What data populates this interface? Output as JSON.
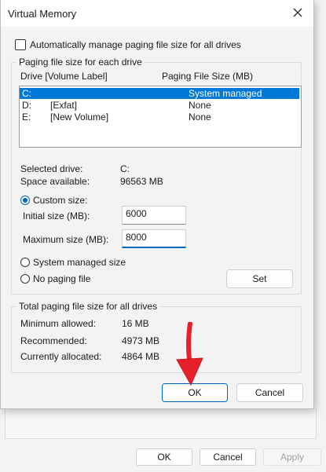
{
  "parent": {
    "ok_label": "OK",
    "cancel_label": "Cancel",
    "apply_label": "Apply"
  },
  "dialog": {
    "title": "Virtual Memory",
    "auto_manage_label": "Automatically manage paging file size for all drives",
    "auto_manage_checked": false,
    "per_drive_group": "Paging file size for each drive",
    "columns": {
      "drive": "Drive  [Volume Label]",
      "size": "Paging File Size (MB)"
    },
    "drives": [
      {
        "drive": "C:",
        "label": "",
        "size": "System managed",
        "selected": true
      },
      {
        "drive": "D:",
        "label": "[Exfat]",
        "size": "None",
        "selected": false
      },
      {
        "drive": "E:",
        "label": "[New Volume]",
        "size": "None",
        "selected": false
      }
    ],
    "selected_drive_label": "Selected drive:",
    "selected_drive_value": "C:",
    "space_available_label": "Space available:",
    "space_available_value": "96563 MB",
    "custom_size_label": "Custom size:",
    "initial_size_label": "Initial size (MB):",
    "initial_size_value": "6000",
    "maximum_size_label": "Maximum size (MB):",
    "maximum_size_value": "8000",
    "system_managed_label": "System managed size",
    "no_paging_label": "No paging file",
    "set_label": "Set",
    "total_group": "Total paging file size for all drives",
    "minimum_label": "Minimum allowed:",
    "minimum_value": "16 MB",
    "recommended_label": "Recommended:",
    "recommended_value": "4973 MB",
    "allocated_label": "Currently allocated:",
    "allocated_value": "4864 MB",
    "ok_label": "OK",
    "cancel_label": "Cancel"
  },
  "colors": {
    "accent": "#0067c0",
    "selection": "#0078d7",
    "annotation_arrow": "#e8202a"
  }
}
